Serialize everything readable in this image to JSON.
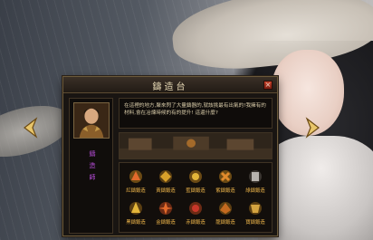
{
  "window": {
    "title": "鑄造台",
    "close_label": "×"
  },
  "character": {
    "name": "鑄造師"
  },
  "description": "在這裡的地方,聚來閃了大量鑄器的,就該挑最有出氣的!我擁有的材料,會在冶煉時候的有的提升! 這還什麼?",
  "items": [
    {
      "label": "紅鑄鍛造",
      "color": "#e26a2c"
    },
    {
      "label": "黃鑄鍛造",
      "color": "#d9a02a"
    },
    {
      "label": "藍鑄鍛造",
      "color": "#3d82d0"
    },
    {
      "label": "紫鑄鍛造",
      "color": "#9a4fd0"
    },
    {
      "label": "綠鑄鍛造",
      "color": "#4aa84a"
    },
    {
      "label": "黑鑄鍛造",
      "color": "#6b6b6b"
    },
    {
      "label": "金鑄鍛造",
      "color": "#e3b53a"
    },
    {
      "label": "赤鑄鍛造",
      "color": "#c8372a"
    },
    {
      "label": "龍鑄鍛造",
      "color": "#c46a20"
    },
    {
      "label": "寶鑄鍛造",
      "color": "#d4a340"
    }
  ]
}
